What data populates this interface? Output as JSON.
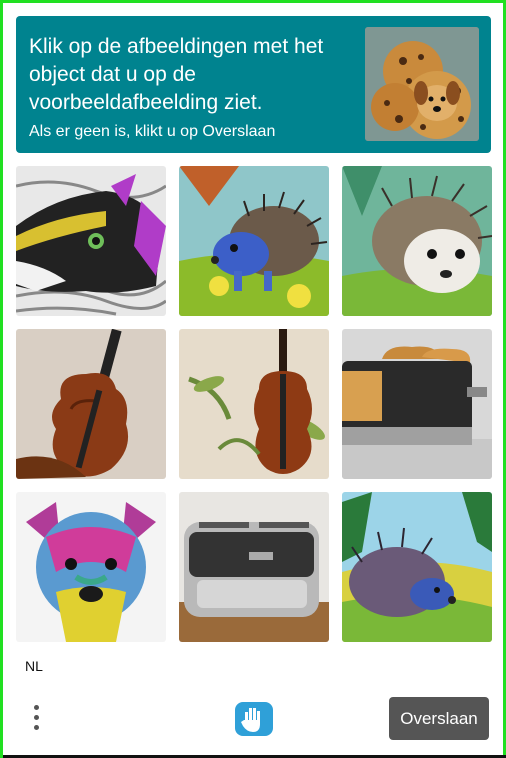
{
  "header": {
    "title": "Klik op de afbeeldingen met het object dat u op de voorbeeldafbeelding ziet.",
    "subtitle": "Als er geen is, klikt u op Overslaan",
    "sample_image": "cookie-dog"
  },
  "grid": {
    "tiles": [
      {
        "subject": "zebra-dog"
      },
      {
        "subject": "hedgehog-painting-blue"
      },
      {
        "subject": "hedgehog-painting"
      },
      {
        "subject": "violin"
      },
      {
        "subject": "violin-with-plant"
      },
      {
        "subject": "toaster"
      },
      {
        "subject": "colorful-dog"
      },
      {
        "subject": "toaster-steel"
      },
      {
        "subject": "hedgehog-landscape"
      }
    ]
  },
  "footer": {
    "language": "NL",
    "skip_label": "Overslaan",
    "menu_icon": "vertical-dots-icon",
    "logo_icon": "hand-logo-icon"
  },
  "colors": {
    "header_bg": "#00838f",
    "frame_border": "#21e021",
    "skip_button_bg": "#555555"
  }
}
